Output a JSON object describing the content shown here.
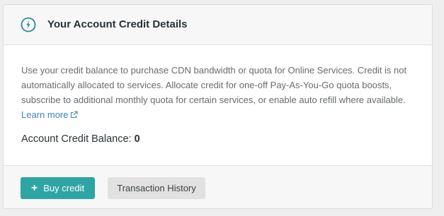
{
  "card": {
    "title": "Your Account Credit Details",
    "icon": "credit-bolt-icon",
    "description": "Use your credit balance to purchase CDN bandwidth or quota for Online Services. Credit is not automatically allocated to services. Allocate credit for one-off Pay-As-You-Go quota boosts, subscribe to additional monthly quota for certain services, or enable auto refill where available.",
    "learn_more_label": "Learn more",
    "balance_label": "Account Credit Balance:",
    "balance_value": "0"
  },
  "footer": {
    "buy_label": "Buy credit",
    "buy_icon": "plus-icon",
    "history_label": "Transaction History"
  },
  "colors": {
    "accent": "#2fa4a4",
    "link": "#3a84c4",
    "icon": "#2a8b9a"
  }
}
